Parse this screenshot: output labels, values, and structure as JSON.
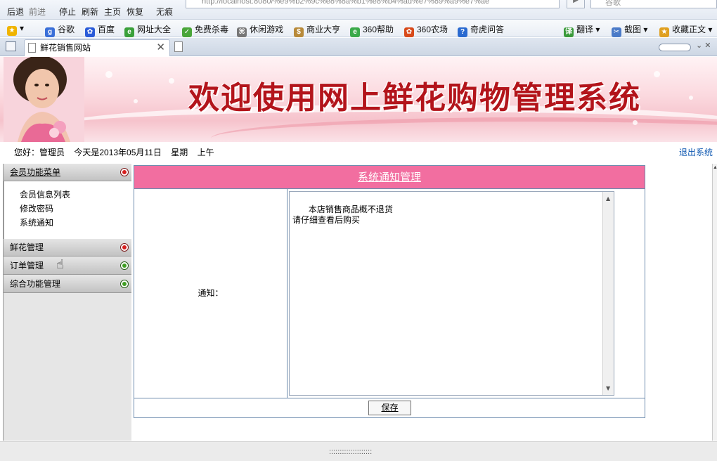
{
  "browser": {
    "nav": {
      "back": "后退",
      "forward": "前进",
      "stop": "停止",
      "refresh": "刷新",
      "home": "主页",
      "restore": "恢复",
      "incognito": "无痕"
    },
    "address": "http://localhost:8080/%e9%b2%9c%e8%8a%b1%e8%b4%ad%e7%89%a9%e7%ae",
    "search_placeholder": "谷歌",
    "favorites": [
      "谷歌",
      "百度",
      "网址大全",
      "免费杀毒",
      "休闲游戏",
      "商业大亨",
      "360帮助",
      "360农场",
      "奇虎问答"
    ],
    "right_tools": {
      "translate": "翻译",
      "screenshot": "截图",
      "collect": "收藏正文"
    },
    "tab_title": "鲜花销售网站"
  },
  "banner": {
    "title": "欢迎使用网上鲜花购物管理系统"
  },
  "greeting": {
    "hello": "您好：管理员",
    "date": "今天是2013年05月11日",
    "weekday": "星期",
    "period": "上午",
    "logout": "退出系统"
  },
  "menu": {
    "member_head": "会员功能菜单",
    "member_items": [
      "会员信息列表",
      "修改密码",
      "系统通知"
    ],
    "flower_head": "鲜花管理",
    "order_head": "订单管理",
    "general_head": "综合功能管理"
  },
  "panel": {
    "title": "系统通知管理",
    "label": "通知：",
    "notice_text": "本店销售商品概不退货\n请仔细查看后购买",
    "save": "保存"
  },
  "status": {
    "grip": "::::::::::::::::::::"
  },
  "colors": {
    "panel_header": "#f26ea0",
    "banner_title": "#b3141b",
    "logout_link": "#0c56b0"
  }
}
